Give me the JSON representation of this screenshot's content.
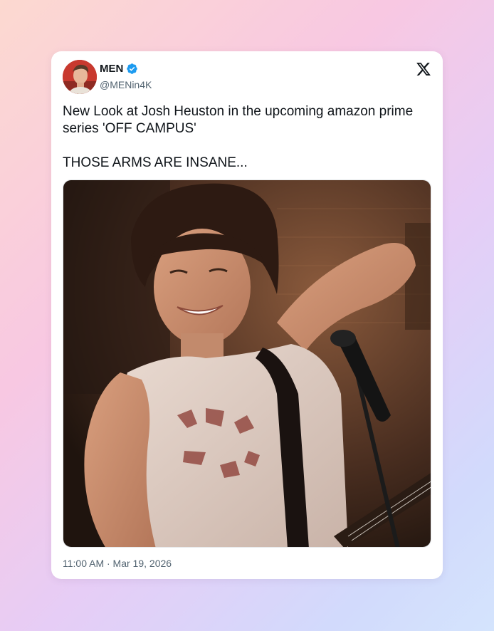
{
  "tweet": {
    "author_name": "MEN",
    "handle": "@MENin4K",
    "text": "New Look at Josh Heuston in the upcoming amazon prime series 'OFF CAMPUS'\n\nTHOSE ARMS ARE INSANE...",
    "timestamp": "11:00 AM · Mar 19, 2026",
    "verified": true
  },
  "icons": {
    "verified": "verified-badge-icon",
    "platform": "x-logo-icon"
  },
  "colors": {
    "text": "#0f1419",
    "secondary_text": "#536471",
    "verified_blue": "#1d9bf0",
    "card_background": "#ffffff"
  }
}
